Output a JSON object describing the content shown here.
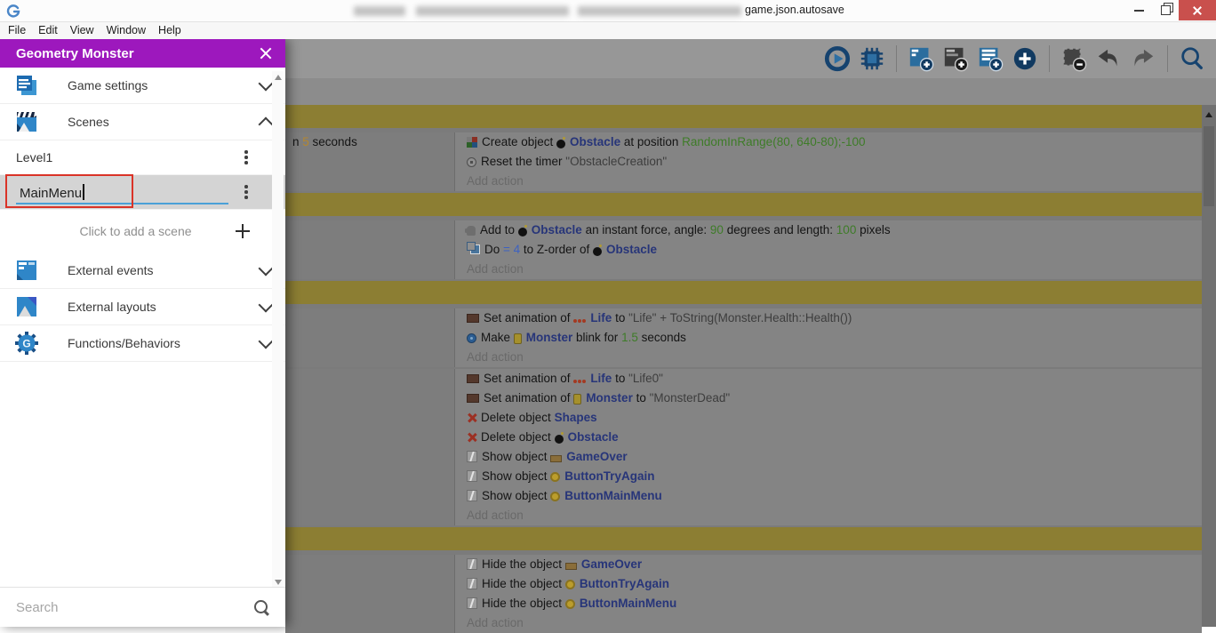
{
  "window": {
    "title_visible": "game.json.autosave",
    "controls": {
      "minimize": "minimize",
      "restore": "restore",
      "close": "close"
    }
  },
  "menu": {
    "items": [
      "File",
      "Edit",
      "View",
      "Window",
      "Help"
    ]
  },
  "toolbar": {
    "groups": [
      [
        "play",
        "debug"
      ],
      [
        "add-event",
        "add-comment",
        "add-subevent",
        "add-circle"
      ],
      [
        "remove-event",
        "undo",
        "redo"
      ],
      [
        "search"
      ]
    ]
  },
  "drawer": {
    "title": "Geometry Monster",
    "items": [
      {
        "label": "Game settings",
        "icon": "game-settings-icon",
        "chevron": "down"
      },
      {
        "label": "Scenes",
        "icon": "scenes-icon",
        "chevron": "up"
      },
      {
        "label": "External events",
        "icon": "external-events-icon",
        "chevron": "down"
      },
      {
        "label": "External layouts",
        "icon": "external-layouts-icon",
        "chevron": "down"
      },
      {
        "label": "Functions/Behaviors",
        "icon": "functions-behaviors-icon",
        "chevron": "down"
      }
    ],
    "scenes": {
      "rows": [
        {
          "label": "Level1"
        }
      ],
      "editing": {
        "value": "MainMenu"
      },
      "add_label": "Click to add a scene"
    },
    "search": {
      "placeholder": "Search"
    }
  },
  "colors": {
    "drawer_header": "#9d18bd",
    "annotation_red": "#da3327",
    "event_bar_yellow": "#8c7e33",
    "object_name_blue": "#273579",
    "expression_green": "#3e7c28",
    "close_button_red": "#c9504d",
    "field_underline_blue": "#4aa0d8"
  },
  "events": {
    "add_action_label": "Add action",
    "rows": [
      {
        "type": "bar"
      },
      {
        "type": "event",
        "condition": [
          [
            "n ",
            "txt"
          ],
          [
            "5",
            "orange"
          ],
          [
            " seconds",
            "txt"
          ]
        ],
        "actions": [
          {
            "icon": "create-object-icon",
            "tokens": [
              [
                "Create object ",
                "txt"
              ],
              {
                "i": "bomb-icon"
              },
              [
                "Obstacle",
                "obj"
              ],
              [
                " at position ",
                "txt"
              ],
              [
                "RandomInRange(80, 640-80);-100",
                "green"
              ]
            ]
          },
          {
            "icon": "timer-icon",
            "tokens": [
              [
                "Reset the timer ",
                "txt"
              ],
              [
                "\"ObstacleCreation\"",
                "str"
              ]
            ]
          }
        ]
      },
      {
        "type": "bar"
      },
      {
        "type": "event",
        "condition": [],
        "actions": [
          {
            "icon": "force-icon",
            "tokens": [
              [
                "Add to ",
                "txt"
              ],
              {
                "i": "bomb-icon"
              },
              [
                "Obstacle",
                "obj"
              ],
              [
                " an instant force, angle: ",
                "txt"
              ],
              [
                "90",
                "green"
              ],
              [
                " degrees and length: ",
                "txt"
              ],
              [
                "100",
                "green"
              ],
              [
                " pixels",
                "txt"
              ]
            ]
          },
          {
            "icon": "zorder-icon",
            "tokens": [
              [
                "Do ",
                "txt"
              ],
              [
                "= 4",
                "blue"
              ],
              [
                " to Z-order of ",
                "txt"
              ],
              {
                "i": "bomb-icon"
              },
              [
                "Obstacle",
                "obj"
              ]
            ]
          }
        ]
      },
      {
        "type": "bar"
      },
      {
        "type": "event",
        "condition": [],
        "actions": [
          {
            "icon": "anim-icon",
            "tokens": [
              [
                "Set animation of ",
                "txt"
              ],
              {
                "i": "life-icon"
              },
              [
                "Life",
                "obj"
              ],
              [
                " to ",
                "txt"
              ],
              [
                "\"Life\" + ToString(Monster.Health::Health())",
                "str"
              ]
            ]
          },
          {
            "icon": "blink-icon",
            "tokens": [
              [
                "Make ",
                "txt"
              ],
              {
                "i": "monster-icon"
              },
              [
                "Monster",
                "obj"
              ],
              [
                " blink for ",
                "txt"
              ],
              [
                "1.5",
                "green"
              ],
              [
                " seconds",
                "txt"
              ]
            ]
          }
        ]
      },
      {
        "type": "event",
        "condition": [],
        "actions": [
          {
            "icon": "anim-icon",
            "tokens": [
              [
                "Set animation of ",
                "txt"
              ],
              {
                "i": "life-icon"
              },
              [
                "Life",
                "obj"
              ],
              [
                " to ",
                "txt"
              ],
              [
                "\"Life0\"",
                "str"
              ]
            ]
          },
          {
            "icon": "anim-icon",
            "tokens": [
              [
                "Set animation of ",
                "txt"
              ],
              {
                "i": "monster-icon"
              },
              [
                "Monster",
                "obj"
              ],
              [
                " to ",
                "txt"
              ],
              [
                "\"MonsterDead\"",
                "str"
              ]
            ]
          },
          {
            "icon": "delete-icon",
            "tokens": [
              [
                "Delete object ",
                "txt"
              ],
              [
                "Shapes",
                "obj"
              ]
            ]
          },
          {
            "icon": "delete-icon",
            "tokens": [
              [
                "Delete object ",
                "txt"
              ],
              {
                "i": "bomb-icon"
              },
              [
                "Obstacle",
                "obj"
              ]
            ]
          },
          {
            "icon": "show-icon",
            "tokens": [
              [
                "Show object ",
                "txt"
              ],
              {
                "i": "gameover-icon"
              },
              [
                "GameOver",
                "obj"
              ]
            ]
          },
          {
            "icon": "show-icon",
            "tokens": [
              [
                "Show object ",
                "txt"
              ],
              {
                "i": "coin-icon"
              },
              [
                "ButtonTryAgain",
                "obj"
              ]
            ]
          },
          {
            "icon": "show-icon",
            "tokens": [
              [
                "Show object ",
                "txt"
              ],
              {
                "i": "coin-icon"
              },
              [
                "ButtonMainMenu",
                "obj"
              ]
            ]
          }
        ]
      },
      {
        "type": "bar"
      },
      {
        "type": "event",
        "condition": [],
        "actions": [
          {
            "icon": "hide-icon",
            "tokens": [
              [
                "Hide the object ",
                "txt"
              ],
              {
                "i": "gameover-icon"
              },
              [
                "GameOver",
                "obj"
              ]
            ]
          },
          {
            "icon": "hide-icon",
            "tokens": [
              [
                "Hide the object ",
                "txt"
              ],
              {
                "i": "coin-icon"
              },
              [
                "ButtonTryAgain",
                "obj"
              ]
            ]
          },
          {
            "icon": "hide-icon",
            "tokens": [
              [
                "Hide the object ",
                "txt"
              ],
              {
                "i": "coin-icon"
              },
              [
                "ButtonMainMenu",
                "obj"
              ]
            ]
          }
        ]
      }
    ]
  }
}
